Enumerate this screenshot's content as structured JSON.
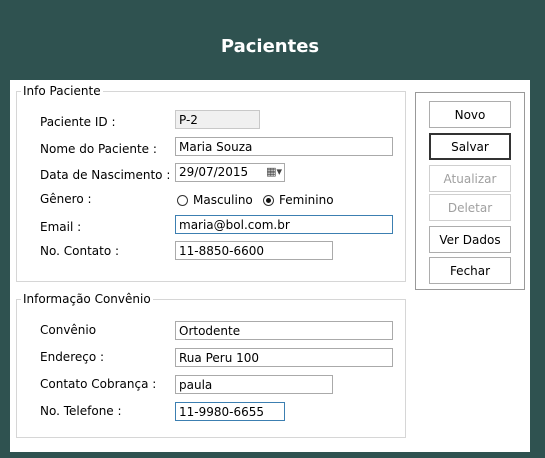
{
  "header": {
    "title": "Pacientes"
  },
  "info_paciente": {
    "legend": "Info Paciente",
    "paciente_id": {
      "label": "Paciente ID :",
      "value": "P-2"
    },
    "nome": {
      "label": "Nome do Paciente :",
      "value": "Maria Souza"
    },
    "data_nascimento": {
      "label": "Data de Nascimento :",
      "value": "29/07/2015"
    },
    "genero": {
      "label": "Gênero :",
      "option_masculino": "Masculino",
      "option_feminino": "Feminino",
      "selected": "Feminino"
    },
    "email": {
      "label": "Email :",
      "value": "maria@bol.com.br"
    },
    "contato": {
      "label": "No. Contato :",
      "value": "11-8850-6600"
    }
  },
  "info_convenio": {
    "legend": "Informação Convênio",
    "convenio": {
      "label": "Convênio",
      "value": "Ortodente"
    },
    "endereco": {
      "label": "Endereço :",
      "value": "Rua Peru 100"
    },
    "contato_cobranca": {
      "label": "Contato Cobrança :",
      "value": "paula"
    },
    "telefone": {
      "label": "No. Telefone :",
      "value": "11-9980-6655"
    }
  },
  "buttons": {
    "novo": "Novo",
    "salvar": "Salvar",
    "atualizar": "Atualizar",
    "deletar": "Deletar",
    "ver_dados": "Ver Dados",
    "fechar": "Fechar"
  },
  "icons": {
    "calendar": "calendar-icon",
    "dropdown": "chevron-down-icon"
  },
  "colors": {
    "header_bg": "#2f5250",
    "focus_border": "#3c7fb1"
  }
}
